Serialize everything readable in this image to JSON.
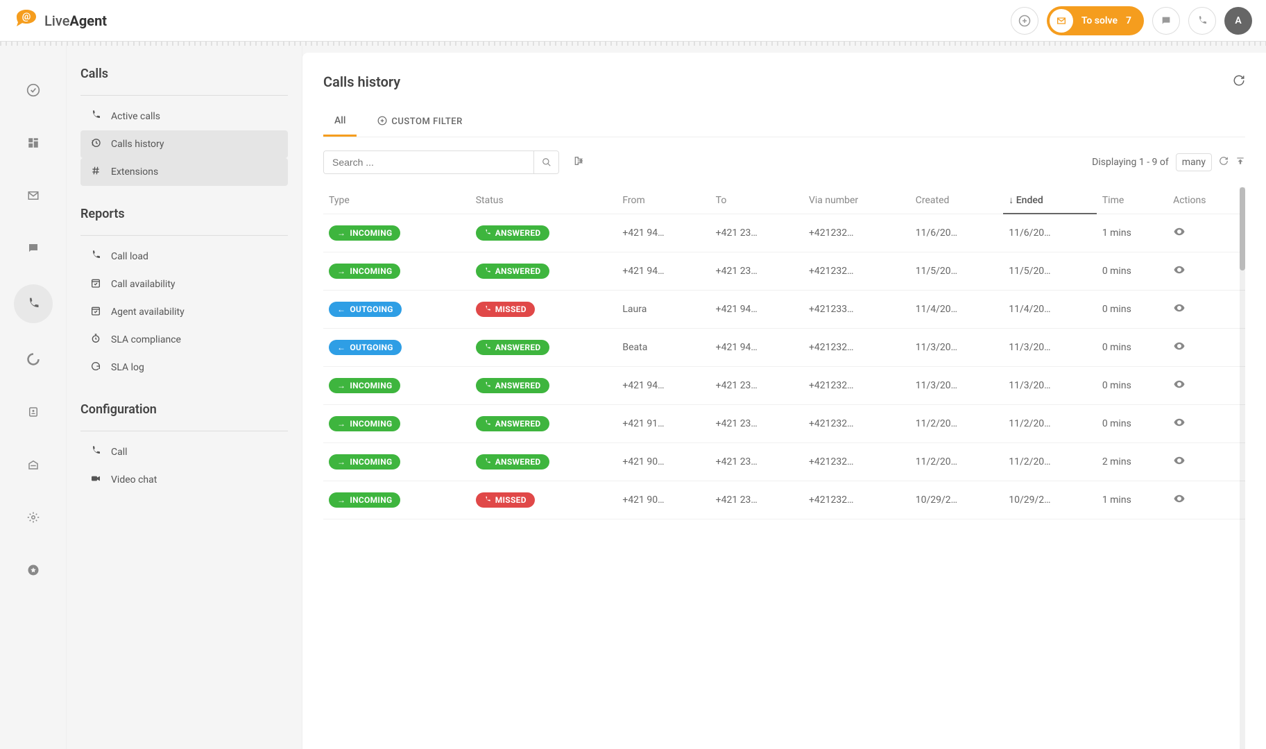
{
  "header": {
    "brand_prefix": "Live",
    "brand_suffix": "Agent",
    "to_solve_label": "To solve",
    "to_solve_count": "7",
    "avatar_letter": "A"
  },
  "sidebar": {
    "calls_section": "Calls",
    "reports_section": "Reports",
    "config_section": "Configuration",
    "calls_items": [
      {
        "label": "Active calls",
        "icon": "phone"
      },
      {
        "label": "Calls history",
        "icon": "history"
      },
      {
        "label": "Extensions",
        "icon": "hash"
      }
    ],
    "reports_items": [
      {
        "label": "Call load",
        "icon": "phone"
      },
      {
        "label": "Call availability",
        "icon": "calendar-check"
      },
      {
        "label": "Agent availability",
        "icon": "calendar-check"
      },
      {
        "label": "SLA compliance",
        "icon": "clock"
      },
      {
        "label": "SLA log",
        "icon": "refresh"
      }
    ],
    "config_items": [
      {
        "label": "Call",
        "icon": "phone"
      },
      {
        "label": "Video chat",
        "icon": "video"
      }
    ]
  },
  "main": {
    "title": "Calls history",
    "tabs": {
      "all": "All",
      "custom_filter": "CUSTOM FILTER"
    },
    "search_placeholder": "Search ...",
    "pagination_prefix": "Displaying 1 - 9 of",
    "page_size": "many"
  },
  "table": {
    "headers": {
      "type": "Type",
      "status": "Status",
      "from": "From",
      "to": "To",
      "via": "Via number",
      "created": "Created",
      "ended": "Ended",
      "time": "Time",
      "actions": "Actions"
    },
    "rows": [
      {
        "type": "INCOMING",
        "status": "ANSWERED",
        "from": "+421 94…",
        "to": "+421 23…",
        "via": "+421232…",
        "created": "11/6/20…",
        "ended": "11/6/20…",
        "time": "1 mins"
      },
      {
        "type": "INCOMING",
        "status": "ANSWERED",
        "from": "+421 94…",
        "to": "+421 23…",
        "via": "+421232…",
        "created": "11/5/20…",
        "ended": "11/5/20…",
        "time": "0 mins"
      },
      {
        "type": "OUTGOING",
        "status": "MISSED",
        "from": "Laura",
        "to": "+421 94…",
        "via": "+421233…",
        "created": "11/4/20…",
        "ended": "11/4/20…",
        "time": "0 mins"
      },
      {
        "type": "OUTGOING",
        "status": "ANSWERED",
        "from": "Beata",
        "to": "+421 94…",
        "via": "+421232…",
        "created": "11/3/20…",
        "ended": "11/3/20…",
        "time": "0 mins"
      },
      {
        "type": "INCOMING",
        "status": "ANSWERED",
        "from": "+421 94…",
        "to": "+421 23…",
        "via": "+421232…",
        "created": "11/3/20…",
        "ended": "11/3/20…",
        "time": "0 mins"
      },
      {
        "type": "INCOMING",
        "status": "ANSWERED",
        "from": "+421 91…",
        "to": "+421 23…",
        "via": "+421232…",
        "created": "11/2/20…",
        "ended": "11/2/20…",
        "time": "0 mins"
      },
      {
        "type": "INCOMING",
        "status": "ANSWERED",
        "from": "+421 90…",
        "to": "+421 23…",
        "via": "+421232…",
        "created": "11/2/20…",
        "ended": "11/2/20…",
        "time": "2 mins"
      },
      {
        "type": "INCOMING",
        "status": "MISSED",
        "from": "+421 90…",
        "to": "+421 23…",
        "via": "+421232…",
        "created": "10/29/2…",
        "ended": "10/29/2…",
        "time": "1 mins"
      }
    ]
  }
}
